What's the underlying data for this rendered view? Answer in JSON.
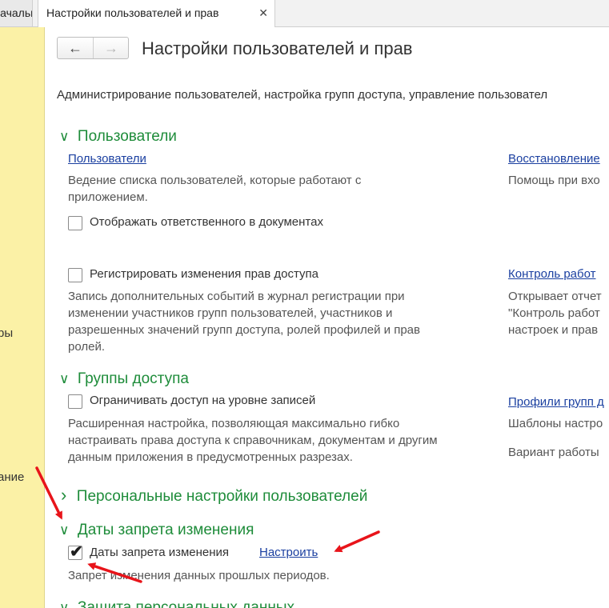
{
  "tabs": {
    "prev_label": "Начальная страница",
    "active_label": "Настройки пользователей и прав",
    "close_glyph": "✕"
  },
  "sidebar": {
    "items": [
      "Функции для технического специалиста, работы",
      "Администрирование"
    ],
    "fragments": [
      "ры",
      "ание"
    ]
  },
  "nav": {
    "back_glyph": "🡐",
    "forward_glyph": "🡒"
  },
  "page_title": "Настройки пользователей и прав",
  "description": "Администрирование пользователей, настройка групп доступа, управление пользовател",
  "users_section": {
    "title": "Пользователи",
    "users_link": "Пользователи",
    "users_desc_line1": "Ведение списка пользователей, которые работают с",
    "users_desc_line2": "приложением.",
    "responsible_checkbox": "Отображать ответственного в документах",
    "restore_link": "Восстановление",
    "restore_desc": "Помощь при вхо",
    "register_checkbox": "Регистрировать изменения прав доступа",
    "register_desc_1": "Запись дополнительных событий в журнал регистрации при",
    "register_desc_2": "изменении участников групп пользователей, участников и",
    "register_desc_3": "разрешенных значений групп доступа, ролей профилей и прав",
    "register_desc_4": "ролей.",
    "control_link": "Контроль работ",
    "control_desc_1": "Открывает отчет",
    "control_desc_2": "\"Контроль работ",
    "control_desc_3": "настроек и прав"
  },
  "access_section": {
    "title": "Группы доступа",
    "record_checkbox": "Ограничивать доступ на уровне записей",
    "record_desc_1": "Расширенная настройка, позволяющая максимально гибко",
    "record_desc_2": "настраивать права доступа к справочникам, документам и другим",
    "record_desc_3": "данным приложения в предусмотренных разрезах.",
    "profiles_link": "Профили групп д",
    "profiles_desc": "Шаблоны настро",
    "variant_label": "Вариант работы"
  },
  "personal_section": {
    "title": "Персональные настройки пользователей"
  },
  "dates_section": {
    "title": "Даты запрета изменения",
    "checkbox_label": "Даты запрета изменения",
    "checked": true,
    "configure_link": "Настроить",
    "desc": "Запрет изменения данных прошлых периодов."
  },
  "next_section": {
    "title": "Защита персональных данных"
  },
  "glyphs": {
    "expanded": "∨",
    "collapsed": "›",
    "check": "✔"
  },
  "colors": {
    "section_green": "#1e8c3a",
    "link_blue": "#1a3fa0",
    "sidebar_yellow": "#fbf1a6",
    "annotation_red": "#e8141a"
  }
}
